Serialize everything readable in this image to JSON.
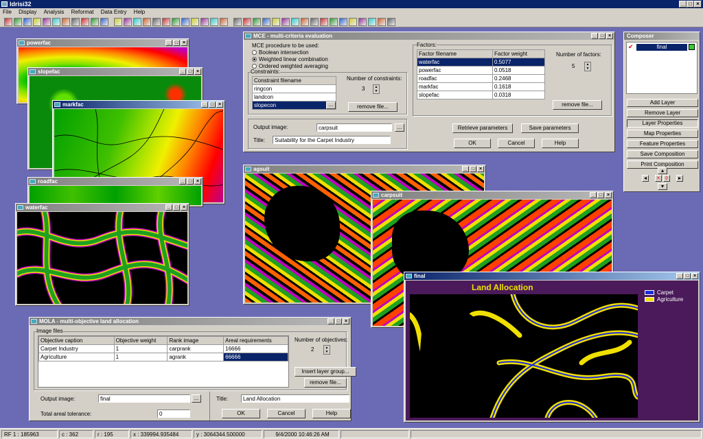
{
  "app": {
    "title": "Idrisi32"
  },
  "menu": [
    "File",
    "Display",
    "Analysis",
    "Reformat",
    "Data Entry",
    "Help"
  ],
  "colors": {
    "carpet": "#1a2ad8",
    "agriculture": "#f0e000",
    "titlebar_active": "#0a246a",
    "desktop": "#6b6bb5"
  },
  "windows": {
    "powerfac": "powerfac",
    "slopefac": "slopefac",
    "markfac": "markfac",
    "roadfac": "roadfac",
    "waterfac": "waterfac",
    "agsuit": "agsuit",
    "carpsuit": "carpsuit",
    "final": "final"
  },
  "mce": {
    "title": "MCE - multi-criteria evaluation",
    "procedure_label": "MCE procedure to be used:",
    "options": [
      "Boolean intersection",
      "Weighted linear combination",
      "Ordered weighted averaging"
    ],
    "selected_option": 1,
    "constraints_label": "Constraints:",
    "constraint_header": "Constraint filename",
    "constraints": [
      "ringcon",
      "landcon",
      "slopecon"
    ],
    "num_constraints_label": "Number of constraints:",
    "num_constraints": "3",
    "remove_file": "remove file...",
    "factors_label": "Factors:",
    "factor_headers": [
      "Factor filename",
      "Factor weight"
    ],
    "factors": [
      [
        "waterfac",
        "0.5077"
      ],
      [
        "powerfac",
        "0.0518"
      ],
      [
        "roadfac",
        "0.2468"
      ],
      [
        "markfac",
        "0.1618"
      ],
      [
        "slopefac",
        "0.0318"
      ]
    ],
    "num_factors_label": "Number of factors:",
    "num_factors": "5",
    "output_label": "Output image:",
    "output_value": "carpsuit",
    "title_label": "Title:",
    "title_value": "Suitability for the Carpet Industry",
    "retrieve": "Retrieve parameters",
    "save": "Save parameters",
    "ok": "OK",
    "cancel": "Cancel",
    "help": "Help",
    "browse": "..."
  },
  "mola": {
    "title": "MOLA - multi-objective land allocation",
    "image_files_label": "Image files",
    "headers": [
      "Objective caption",
      "Objective weight",
      "Rank image",
      "Areal requirements"
    ],
    "rows": [
      [
        "Carpet Industry",
        "1",
        "carprank",
        "16666"
      ],
      [
        "Agriculture",
        "1",
        "agrank",
        "66666"
      ]
    ],
    "num_objectives_label": "Number of objectives:",
    "num_objectives": "2",
    "insert_layer_group": "Insert layer group...",
    "remove_file": "remove file...",
    "output_label": "Output image:",
    "output_value": "final",
    "title_label": "Title:",
    "title_value": "Land Allocation",
    "tolerance_label": "Total areal tolerance:",
    "tolerance_value": "0",
    "ok": "OK",
    "cancel": "Cancel",
    "help": "Help",
    "browse": "..."
  },
  "final_map": {
    "heading": "Land Allocation",
    "legend": [
      "Carpet",
      "Agriculture"
    ]
  },
  "composer": {
    "title": "Composer",
    "layer": "final",
    "buttons": [
      "Add Layer",
      "Remove Layer",
      "Layer Properties",
      "Map Properties",
      "Feature Properties",
      "Save Composition",
      "Print Composition"
    ]
  },
  "status": {
    "rf": "RF  1 : 185963",
    "c": "c : 362",
    "r": "r : 195",
    "x": "x : 339994.935484",
    "y": "y : 3064344.500000",
    "datetime": "9/4/2000  10:46:26 AM"
  }
}
